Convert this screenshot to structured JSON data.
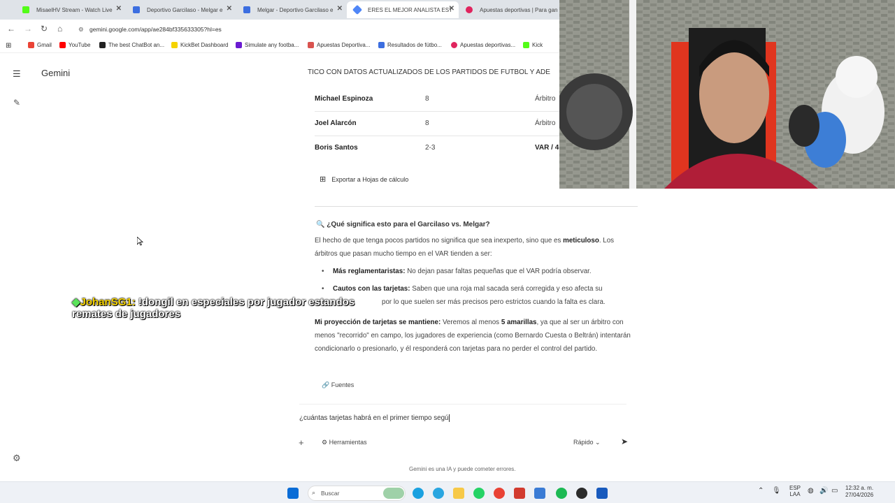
{
  "tabs": [
    {
      "label": "MisaelHV Stream - Watch Live",
      "color": "#53fc18"
    },
    {
      "label": "Deportivo Garcilaso - Melgar e",
      "color": "#3c6ee0"
    },
    {
      "label": "Melgar - Deportivo Garcilaso e",
      "color": "#3c6ee0"
    },
    {
      "label": "ERES EL MEJOR ANALISTA EST",
      "color": "#4f86f7"
    },
    {
      "label": "Apuestas deportivas | Para gan",
      "color": "#e0245e"
    }
  ],
  "url": "gemini.google.com/app/ae284bf335633305?hl=es",
  "bookmarks": [
    {
      "label": "Gmail",
      "color": "#ea4335"
    },
    {
      "label": "YouTube",
      "color": "#ff0000"
    },
    {
      "label": "The best ChatBot an...",
      "color": "#222222"
    },
    {
      "label": "KickBet Dashboard",
      "color": "#f5d300"
    },
    {
      "label": "Simulate any footba...",
      "color": "#6a1bd1"
    },
    {
      "label": "Apuestas Deportiva...",
      "color": "#d9534f"
    },
    {
      "label": "Resultados de fútbo...",
      "color": "#3c6ee0"
    },
    {
      "label": "Apuestas deportivas...",
      "color": "#e0245e"
    },
    {
      "label": "Kick",
      "color": "#53fc18"
    }
  ],
  "gemini": {
    "brand": "Gemini",
    "content_title": "TICO CON DATOS ACTUALIZADOS DE LOS PARTIDOS DE FUTBOL Y ADE",
    "rows": [
      {
        "name": "Michael Espinoza",
        "value": "8",
        "role": "Árbitro"
      },
      {
        "name": "Joel Alarcón",
        "value": "8",
        "role": "Árbitro"
      },
      {
        "name": "Boris Santos",
        "value": "2-3",
        "role": "VAR / 4"
      }
    ],
    "export_label": "Exportar a Hojas de cálculo",
    "heading": "¿Qué significa esto para el Garcilaso vs. Melgar?",
    "p1a": "El hecho de que tenga pocos partidos no significa que sea inexperto, sino que es ",
    "p1b": "meticuloso",
    "p1c": ". Los árbitros que pasan mucho tiempo en el VAR tienden a ser:",
    "b1t": "Más reglamentaristas:",
    "b1": " No dejan pasar faltas pequeñas que el VAR podría observar.",
    "b2t": "Cautos con las tarjetas:",
    "b2": " Saben que una roja mal sacada será corregida y eso afecta su",
    "b2c": "por lo que suelen ser más precisos pero estrictos cuando la falta es clara.",
    "p2t": "Mi proyección de tarjetas se mantiene:",
    "p2a": " Veremos al menos ",
    "p2b": "5 amarillas",
    "p2c": ", ya que al ser un árbitro con menos \"recorrido\" en campo, los jugadores de experiencia (como Bernardo Cuesta o Beltrán) intentarán condicionarlo o presionarlo, y él responderá con tarjetas para no perder el control del partido.",
    "sources": "Fuentes",
    "prompt": "¿cuántas tarjetas habrá en el primer tiempo segú",
    "tools": "Herramientas",
    "mode": "Rápido",
    "disclaimer": "Gemini es una IA y puede cometer errores."
  },
  "chat": {
    "user": "JohanSG1:",
    "message": " !dongil en especiales por jugador estandos remates de jugadores"
  },
  "taskbar": {
    "search": "Buscar",
    "lang1": "ESP",
    "lang2": "LAA",
    "time": "12:32 a. m.",
    "date": "27/04/2026"
  }
}
